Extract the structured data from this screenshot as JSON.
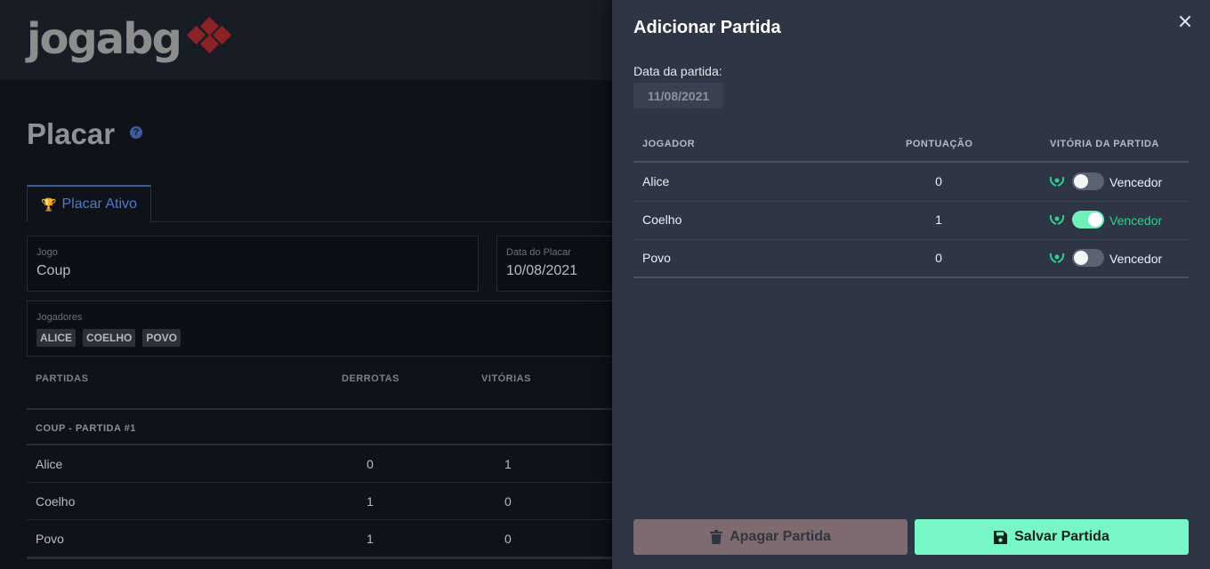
{
  "brand": {
    "logo_text": "jogabg",
    "accent": "#8a2326"
  },
  "page": {
    "title": "Placar",
    "help_icon": "question-circle-icon",
    "help_glyph": "?"
  },
  "tabs": [
    {
      "label": "Placar Ativo",
      "icon": "trophy-icon"
    }
  ],
  "form": {
    "game_label": "Jogo",
    "game_value": "Coup",
    "date_label": "Data do Placar",
    "date_value": "10/08/2021",
    "players_label": "Jogadores",
    "players": [
      "ALICE",
      "COELHO",
      "POVO"
    ]
  },
  "scoreboard": {
    "headers": [
      "PARTIDAS",
      "DERROTAS",
      "VITÓRIAS"
    ],
    "group": "COUP - PARTIDA #1",
    "rows": [
      {
        "name": "Alice",
        "losses": "0",
        "wins": "1"
      },
      {
        "name": "Coelho",
        "losses": "1",
        "wins": "0"
      },
      {
        "name": "Povo",
        "losses": "1",
        "wins": "0"
      }
    ]
  },
  "drawer": {
    "title": "Adicionar Partida",
    "date_label": "Data da partida:",
    "date_value": "11/08/2021",
    "headers": {
      "player": "JOGADOR",
      "score": "PONTUAÇÃO",
      "victory": "VITÓRIA DA PARTIDA"
    },
    "rows": [
      {
        "name": "Alice",
        "score": "0",
        "winner": false,
        "winner_label": "Vencedor"
      },
      {
        "name": "Coelho",
        "score": "1",
        "winner": true,
        "winner_label": "Vencedor"
      },
      {
        "name": "Povo",
        "score": "0",
        "winner": false,
        "winner_label": "Vencedor"
      }
    ],
    "delete_label": "Apagar Partida",
    "save_label": "Salvar Partida",
    "colors": {
      "toggle_on": "#6ff0bb",
      "save_button": "#78f7c6",
      "delete_button": "#7e6b70",
      "laurel": "#2fcf8c"
    }
  }
}
